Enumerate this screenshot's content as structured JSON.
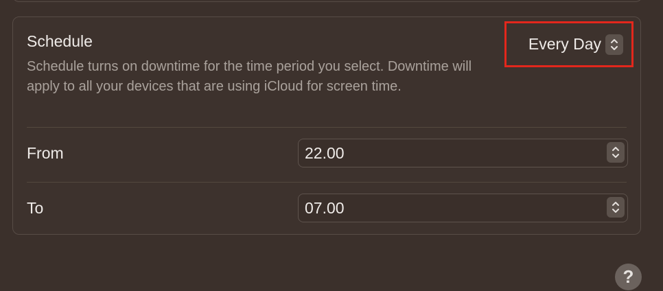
{
  "schedule": {
    "title": "Schedule",
    "description": "Schedule turns on downtime for the time period you select. Downtime will apply to all your devices that are using iCloud for screen time.",
    "frequency_value": "Every Day"
  },
  "from": {
    "label": "From",
    "value": "22.00"
  },
  "to": {
    "label": "To",
    "value": "07.00"
  },
  "help": {
    "label": "?"
  },
  "icons": {
    "frequency": "up-down-chevron-icon",
    "from": "up-down-chevron-icon",
    "to": "up-down-chevron-icon",
    "help": "question-mark-icon"
  },
  "colors": {
    "background": "#3b302b",
    "highlight": "#e3271c",
    "text_primary": "#efebe8",
    "text_secondary": "#aaa29c"
  }
}
